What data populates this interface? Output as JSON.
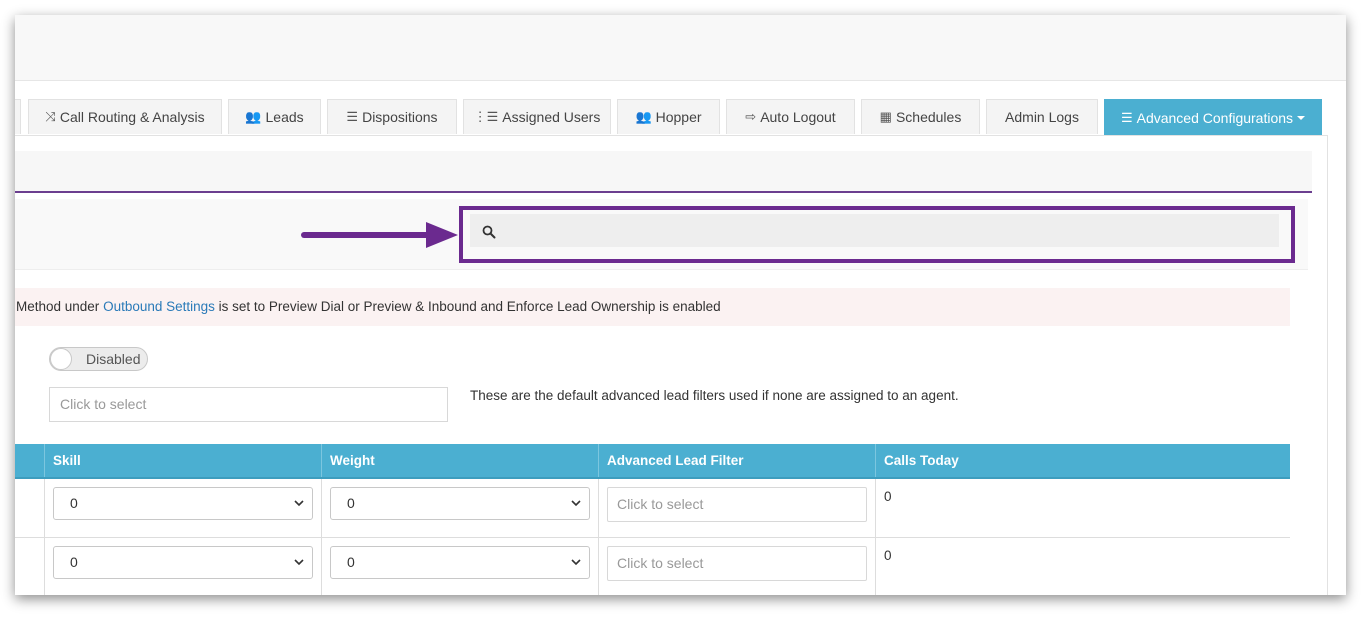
{
  "tabs": [
    {
      "icon": "shuffle-icon",
      "glyph": "⤨",
      "label": "Call Routing & Analysis"
    },
    {
      "icon": "users-icon",
      "glyph": "👥",
      "label": "Leads"
    },
    {
      "icon": "list-icon",
      "glyph": "☰",
      "label": "Dispositions"
    },
    {
      "icon": "ordered-list-icon",
      "glyph": "⋮☰",
      "label": "Assigned Users"
    },
    {
      "icon": "users-icon",
      "glyph": "👥",
      "label": "Hopper"
    },
    {
      "icon": "sign-out-icon",
      "glyph": "⇨",
      "label": "Auto Logout"
    },
    {
      "icon": "calendar-icon",
      "glyph": "▦",
      "label": "Schedules"
    },
    {
      "icon": "",
      "glyph": "",
      "label": "Admin Logs"
    },
    {
      "icon": "server-icon",
      "glyph": "☰",
      "label": "Advanced Configurations",
      "active": true
    }
  ],
  "search": {
    "placeholder": "",
    "value": ""
  },
  "notice": {
    "before": "Method under ",
    "link": "Outbound Settings",
    "after": " is set to Preview Dial or Preview & Inbound and Enforce Lead Ownership is enabled"
  },
  "toggle": {
    "label": "Disabled"
  },
  "default_filter": {
    "placeholder": "Click to select"
  },
  "help_text": "These are the default advanced lead filters used if none are assigned to an agent.",
  "table": {
    "headers": [
      "Skill",
      "Weight",
      "Advanced Lead Filter",
      "Calls Today"
    ],
    "rows": [
      {
        "skill": "0",
        "weight": "0",
        "filter": "Click to select",
        "calls": "0"
      },
      {
        "skill": "0",
        "weight": "0",
        "filter": "Click to select",
        "calls": "0"
      }
    ]
  },
  "colors": {
    "accent": "#4bafd1",
    "highlight": "#6b2a8f",
    "link": "#2a7ab8"
  }
}
